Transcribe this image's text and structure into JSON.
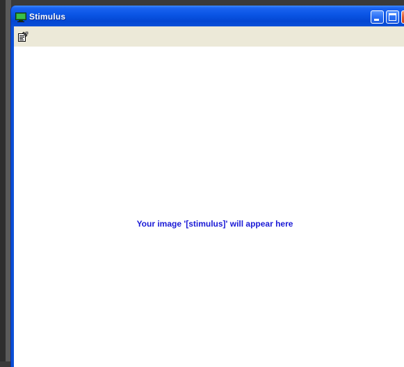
{
  "window": {
    "title": "Stimulus",
    "title_icon": "app-monitor-icon",
    "controls": [
      "minimize-icon",
      "maximize-icon",
      "close-icon"
    ]
  },
  "toolbar": {
    "items": [
      {
        "icon": "properties-icon"
      }
    ]
  },
  "canvas": {
    "placeholder_text": "Your image '[stimulus]' will appear here"
  },
  "colors": {
    "titlebar": "#0a54e4",
    "toolbar_bg": "#ece9d8",
    "canvas_bg": "#ffffff",
    "placeholder_text": "#1a1ad6",
    "close_button": "#e0582f"
  }
}
